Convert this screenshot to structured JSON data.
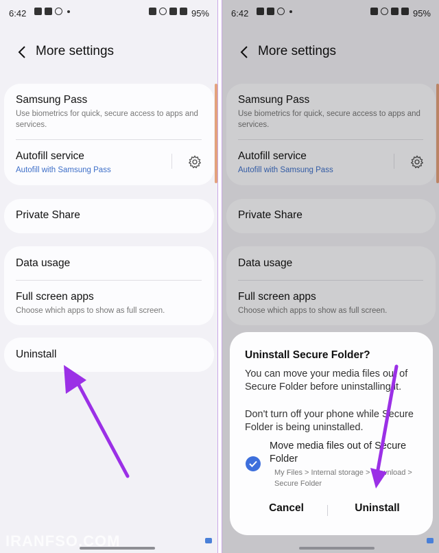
{
  "status": {
    "time": "6:42",
    "battery": "95%"
  },
  "header": {
    "title": "More settings"
  },
  "settings": {
    "samsung_pass": {
      "title": "Samsung Pass",
      "subtitle": "Use biometrics for quick, secure access to apps and services."
    },
    "autofill": {
      "title": "Autofill service",
      "subtitle": "Autofill with Samsung Pass"
    },
    "private_share": {
      "title": "Private Share"
    },
    "data_usage": {
      "title": "Data usage"
    },
    "full_screen": {
      "title": "Full screen apps",
      "subtitle": "Choose which apps to show as full screen."
    },
    "uninstall": {
      "title": "Uninstall"
    }
  },
  "dialog": {
    "title": "Uninstall Secure Folder?",
    "body1": "You can move your media files out of Secure Folder before uninstalling it.",
    "body2": "Don't turn off your phone while Secure Folder is being uninstalled.",
    "option_title": "Move media files out of Secure Folder",
    "option_subtitle": "My Files > Internal storage > Download > Secure Folder",
    "option_checked": true,
    "cancel": "Cancel",
    "uninstall": "Uninstall"
  },
  "watermark": "IRANFSO.COM",
  "colors": {
    "accent_blue": "#3e6fc8",
    "arrow_purple": "#9b30e6",
    "check_blue": "#3d6fdc"
  },
  "icons": [
    "back-arrow-icon",
    "gear-icon",
    "check-icon"
  ]
}
